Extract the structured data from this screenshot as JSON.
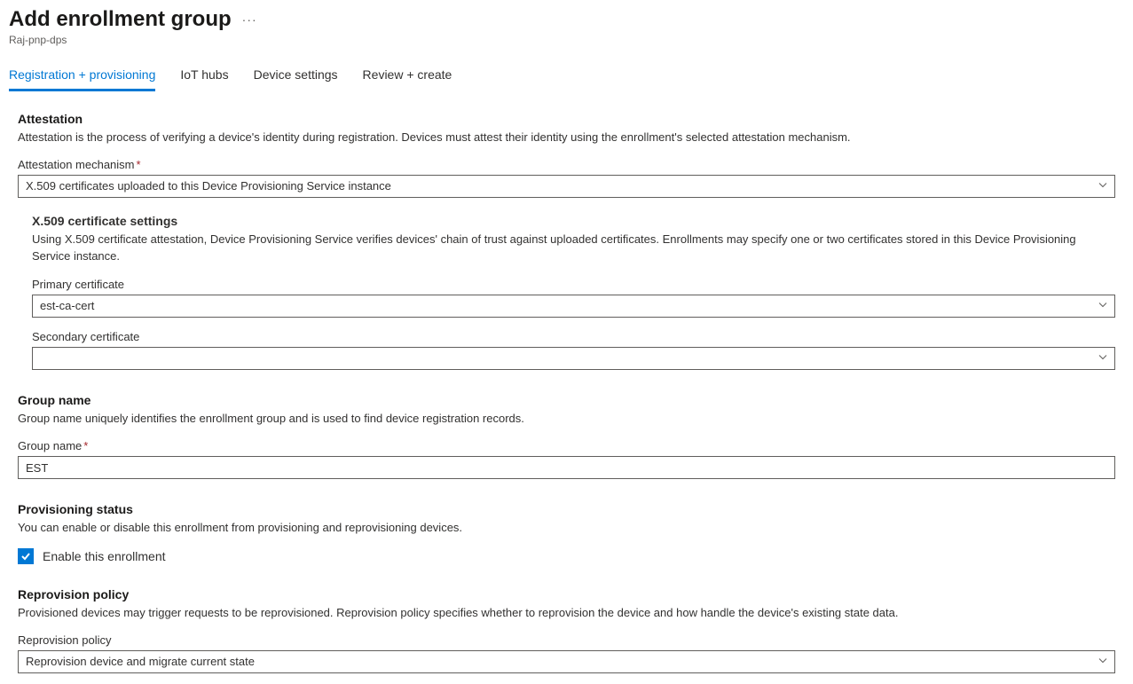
{
  "header": {
    "title": "Add enrollment group",
    "subtitle": "Raj-pnp-dps"
  },
  "tabs": [
    {
      "label": "Registration + provisioning",
      "active": true
    },
    {
      "label": "IoT hubs",
      "active": false
    },
    {
      "label": "Device settings",
      "active": false
    },
    {
      "label": "Review + create",
      "active": false
    }
  ],
  "attestation": {
    "heading": "Attestation",
    "description": "Attestation is the process of verifying a device's identity during registration. Devices must attest their identity using the enrollment's selected attestation mechanism.",
    "mechanism_label": "Attestation mechanism",
    "mechanism_value": "X.509 certificates uploaded to this Device Provisioning Service instance"
  },
  "x509": {
    "heading": "X.509 certificate settings",
    "description": "Using X.509 certificate attestation, Device Provisioning Service verifies devices' chain of trust against uploaded certificates. Enrollments may specify one or two certificates stored in this Device Provisioning Service instance.",
    "primary_label": "Primary certificate",
    "primary_value": "est-ca-cert",
    "secondary_label": "Secondary certificate",
    "secondary_value": ""
  },
  "group": {
    "heading": "Group name",
    "description": "Group name uniquely identifies the enrollment group and is used to find device registration records.",
    "label": "Group name",
    "value": "EST"
  },
  "provisioning": {
    "heading": "Provisioning status",
    "description": "You can enable or disable this enrollment from provisioning and reprovisioning devices.",
    "checkbox_label": "Enable this enrollment",
    "checked": true
  },
  "reprovision": {
    "heading": "Reprovision policy",
    "description": "Provisioned devices may trigger requests to be reprovisioned. Reprovision policy specifies whether to reprovision the device and how handle the device's existing state data.",
    "label": "Reprovision policy",
    "value": "Reprovision device and migrate current state"
  }
}
